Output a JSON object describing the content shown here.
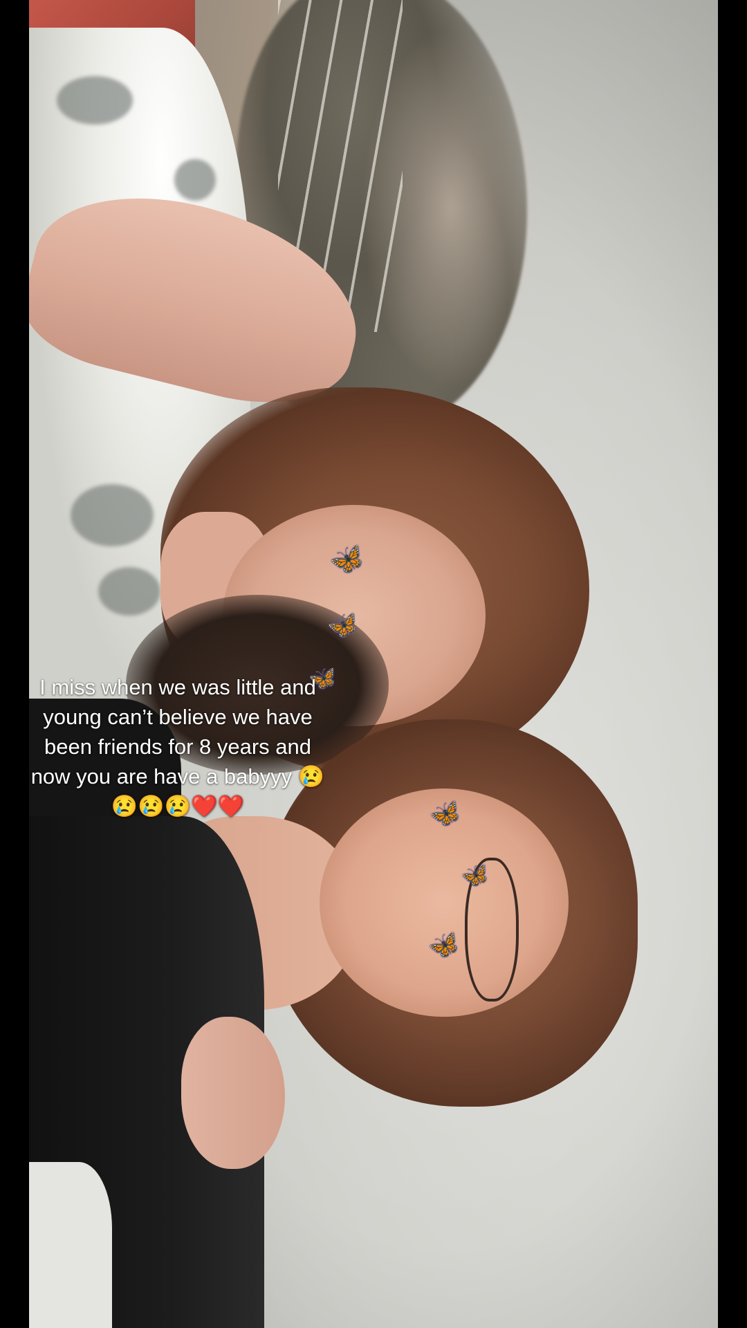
{
  "post": {
    "caption": "I miss when we was little and young can’t believe we have been friends for 8 years and now you are have a babyyy 😢😢😢😢❤️❤️"
  },
  "stickers": {
    "icon": "butterfly-icon",
    "color": "#8d5fd6",
    "glyph": "🦋"
  }
}
